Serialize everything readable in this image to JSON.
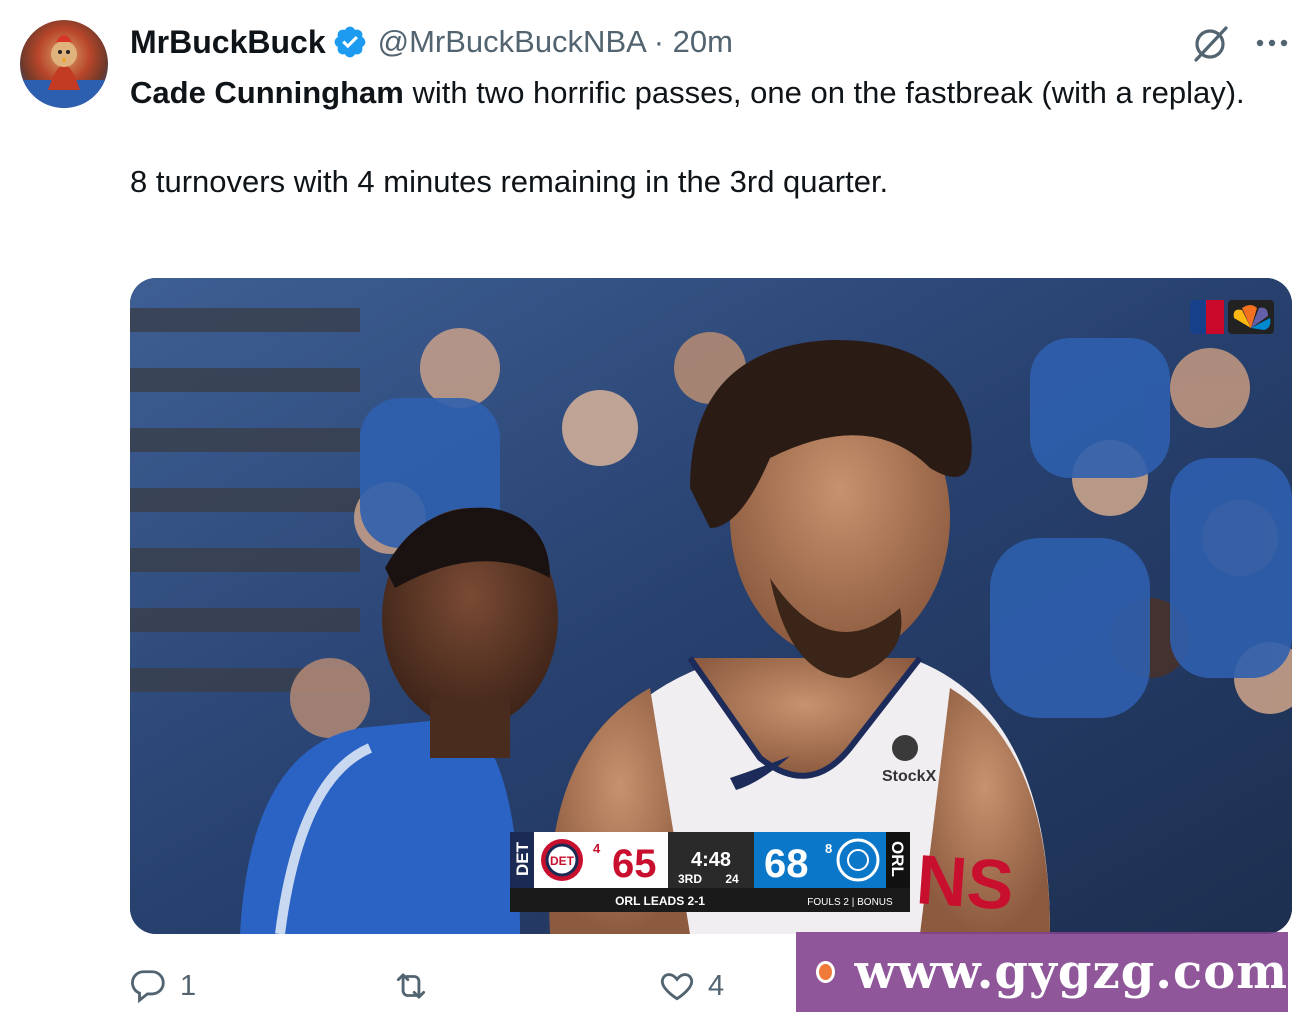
{
  "tweet": {
    "author": {
      "display_name": "MrBuckBuck",
      "handle_line": "@MrBuckBuckNBA · 20m",
      "verified": true
    },
    "text": {
      "mention": "Cade Cunningham",
      "line1_rest": " with two horrific passes, one on the fastbreak (with a replay).",
      "line2": "8 turnovers with 4 minutes remaining in the 3rd quarter."
    },
    "scoreboard": {
      "away_abbr": "DET",
      "away_logo": "DET",
      "away_timeouts": "4",
      "away_score": "65",
      "clock": "4:48",
      "period": "3RD",
      "shot_clock": "24",
      "home_score": "68",
      "home_timeouts": "8",
      "home_abbr": "ORL",
      "ticker": "ORL LEADS 2-1",
      "ticker_right": "FOULS 2 | BONUS"
    },
    "jersey": {
      "sponsor": "StockX",
      "partial_text": "NS"
    },
    "actions": {
      "reply_count": "1",
      "repost_count": "",
      "like_count": "4"
    },
    "icons": [
      "grok-icon",
      "more-icon",
      "verified-badge-icon",
      "reply-icon",
      "repost-icon",
      "like-icon"
    ],
    "colors": {
      "text": "#0f1419",
      "secondary": "#536471",
      "verified": "#1d9bf0"
    }
  },
  "watermark": {
    "text": "www.gygzg.com"
  }
}
